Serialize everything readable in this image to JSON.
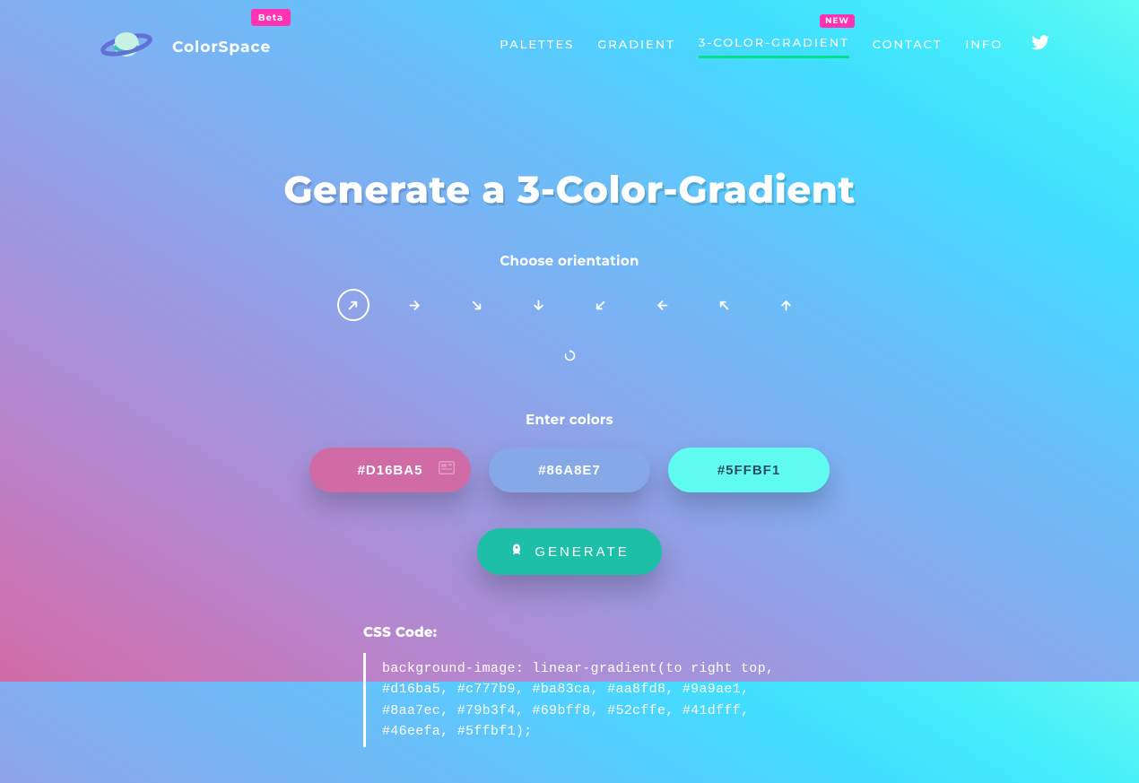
{
  "brand": {
    "name": "ColorSpace",
    "beta": "Beta"
  },
  "nav": {
    "items": [
      {
        "label": "PALETTES",
        "active": false,
        "new": false
      },
      {
        "label": "GRADIENT",
        "active": false,
        "new": false
      },
      {
        "label": "3-COLOR-GRADIENT",
        "active": true,
        "new": true
      },
      {
        "label": "CONTACT",
        "active": false,
        "new": false
      },
      {
        "label": "INFO",
        "active": false,
        "new": false
      }
    ],
    "new_badge": "NEW"
  },
  "page": {
    "title": "Generate a 3-Color-Gradient",
    "orientation_label": "Choose orientation",
    "colors_label": "Enter colors",
    "generate_label": "GENERATE",
    "css_title": "CSS Code:",
    "css_code": "background-image: linear-gradient(to right top, #d16ba5, #c777b9, #ba83ca, #aa8fd8, #9a9ae1, #8aa7ec, #79b3f4, #69bff8, #52cffe, #41dfff, #46eefa, #5ffbf1);"
  },
  "orientation": {
    "options": [
      {
        "name": "up-right",
        "selected": true
      },
      {
        "name": "right",
        "selected": false
      },
      {
        "name": "down-right",
        "selected": false
      },
      {
        "name": "down",
        "selected": false
      },
      {
        "name": "down-left",
        "selected": false
      },
      {
        "name": "left",
        "selected": false
      },
      {
        "name": "up-left",
        "selected": false
      },
      {
        "name": "up",
        "selected": false
      }
    ],
    "circular": {
      "name": "circular",
      "selected": false
    }
  },
  "colors": {
    "c1": "#D16BA5",
    "c2": "#86A8E7",
    "c3": "#5FFBF1"
  }
}
